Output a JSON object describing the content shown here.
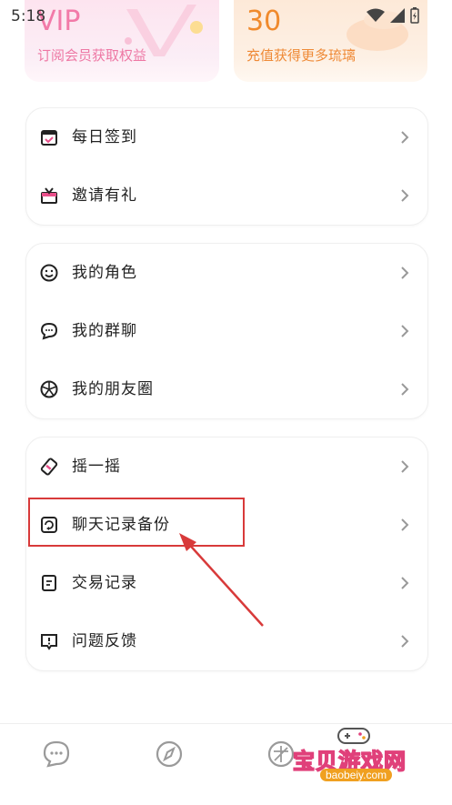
{
  "status_bar": {
    "time": "5:18"
  },
  "top_cards": {
    "vip": {
      "title": "VIP",
      "subtitle": "订阅会员获取权益"
    },
    "coins": {
      "value": "30",
      "subtitle": "充值获得更多琉璃"
    }
  },
  "menu": {
    "group1": [
      {
        "label": "每日签到",
        "icon": "calendar-check-icon"
      },
      {
        "label": "邀请有礼",
        "icon": "gift-icon"
      }
    ],
    "group2": [
      {
        "label": "我的角色",
        "icon": "smiley-icon"
      },
      {
        "label": "我的群聊",
        "icon": "chat-bubbles-icon"
      },
      {
        "label": "我的朋友圈",
        "icon": "aperture-icon"
      }
    ],
    "group3": [
      {
        "label": "摇一摇",
        "icon": "shake-icon"
      },
      {
        "label": "聊天记录备份",
        "icon": "backup-icon"
      },
      {
        "label": "交易记录",
        "icon": "document-icon"
      },
      {
        "label": "问题反馈",
        "icon": "feedback-icon"
      }
    ]
  },
  "bottom_nav": [
    "chat-icon",
    "compass-icon",
    "profile-icon"
  ],
  "watermark": {
    "text": "宝贝游戏网",
    "url": "baobeiy.com"
  },
  "colors": {
    "accent_red": "#d83a3a",
    "vip_pink": "#f27aa8",
    "coin_orange": "#f08a2c"
  }
}
